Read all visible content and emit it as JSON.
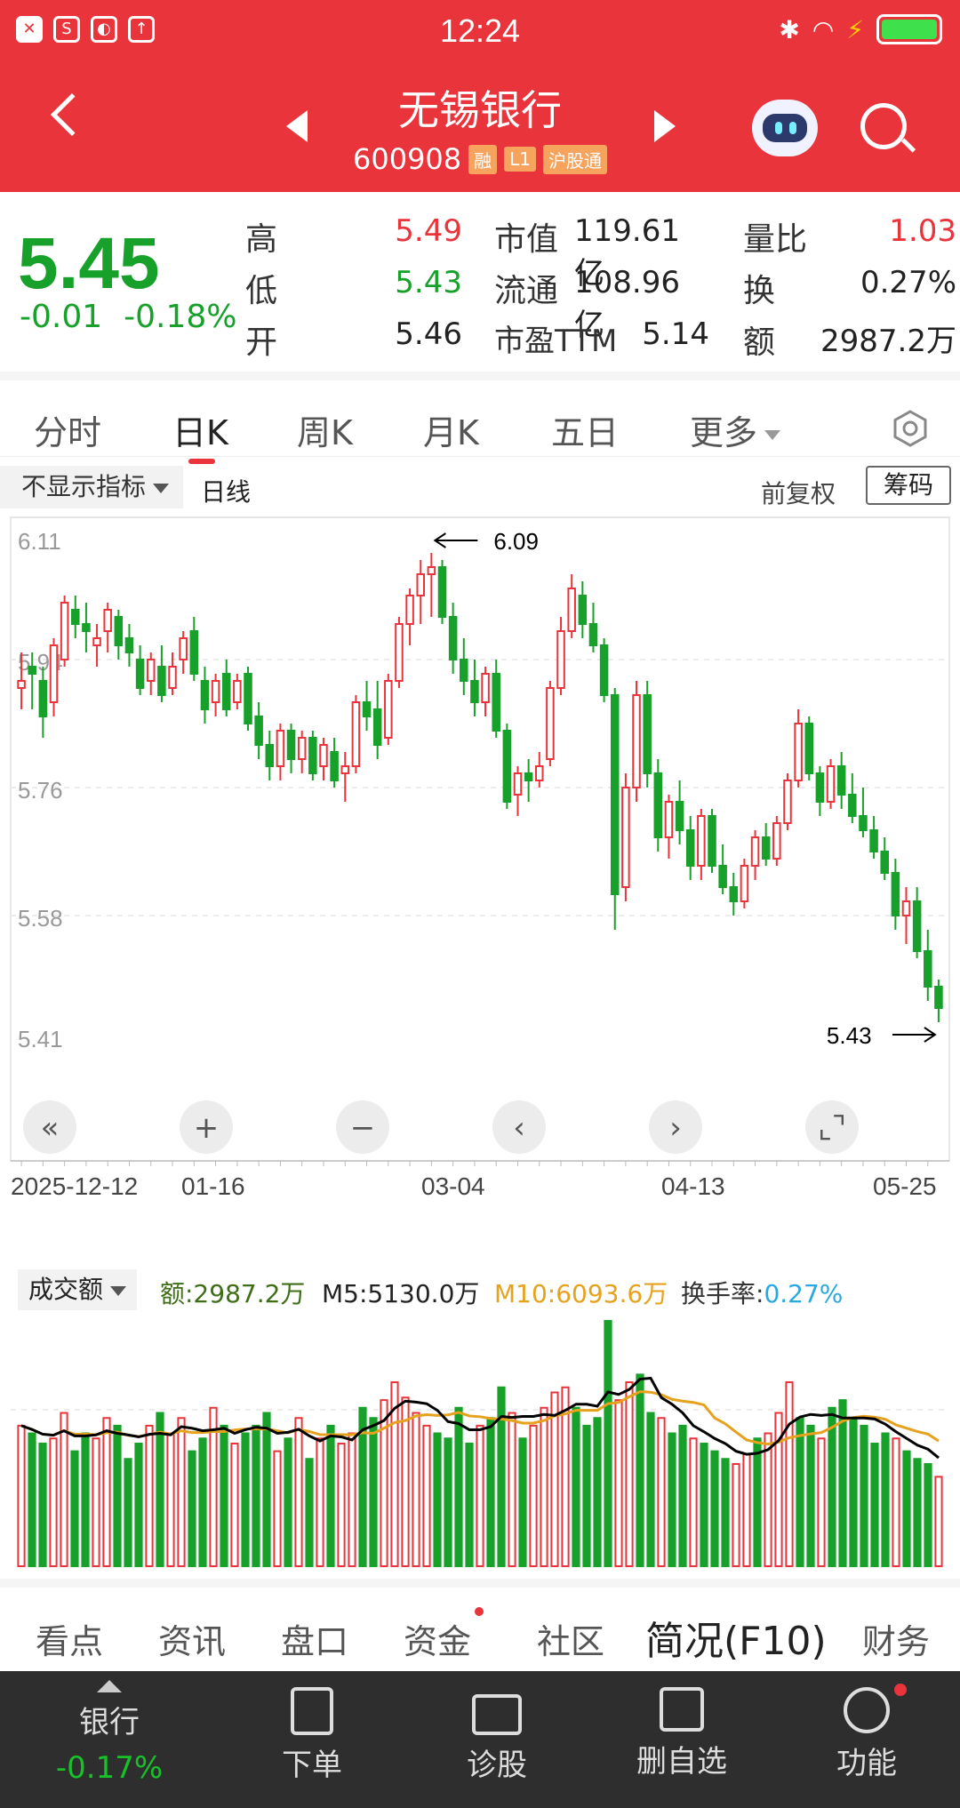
{
  "status_bar": {
    "time": "12:24"
  },
  "header": {
    "stock_name": "无锡银行",
    "stock_code": "600908",
    "tags": [
      "融",
      "L1",
      "沪股通"
    ]
  },
  "quote": {
    "price": "5.45",
    "change": "-0.01",
    "change_pct": "-0.18%",
    "rows": [
      [
        {
          "label": "高",
          "value": "5.49"
        },
        {
          "label": "市值",
          "value": "119.61亿"
        },
        {
          "label": "量比",
          "value": "1.03"
        }
      ],
      [
        {
          "label": "低",
          "value": "5.43"
        },
        {
          "label": "流通",
          "value": "108.96亿"
        },
        {
          "label": "换",
          "value": "0.27%"
        }
      ],
      [
        {
          "label": "开",
          "value": "5.46"
        },
        {
          "label": "市盈TTM",
          "value": "5.14"
        },
        {
          "label": "额",
          "value": "2987.2万"
        }
      ]
    ]
  },
  "tabs": [
    "分时",
    "日K",
    "周K",
    "月K",
    "五日",
    "更多"
  ],
  "indicator_bar": {
    "dropdown": "不显示指标",
    "line_type": "日线",
    "adjust": "前复权",
    "chips_button": "筹码"
  },
  "chart_data": [
    {
      "type": "candlestick",
      "title": "",
      "ylim": [
        5.41,
        6.11
      ],
      "y_ticks": [
        "6.11",
        "5.94",
        "5.76",
        "5.58",
        "5.41"
      ],
      "x_ticks": [
        "2025-12-12",
        "01-16",
        "03-04",
        "04-13",
        "05-25"
      ],
      "annotations": [
        {
          "label": "6.09",
          "kind": "max"
        },
        {
          "label": "5.43",
          "kind": "min"
        }
      ],
      "candles": [
        [
          5.9,
          5.95,
          5.87,
          5.91
        ],
        [
          5.93,
          5.95,
          5.87,
          5.92
        ],
        [
          5.91,
          5.93,
          5.83,
          5.86
        ],
        [
          5.88,
          5.97,
          5.86,
          5.96
        ],
        [
          5.94,
          6.03,
          5.93,
          6.02
        ],
        [
          6.01,
          6.03,
          5.97,
          5.99
        ],
        [
          5.99,
          6.02,
          5.95,
          5.98
        ],
        [
          5.96,
          5.99,
          5.93,
          5.97
        ],
        [
          5.98,
          6.02,
          5.95,
          6.01
        ],
        [
          6.0,
          6.01,
          5.94,
          5.96
        ],
        [
          5.97,
          5.99,
          5.93,
          5.95
        ],
        [
          5.94,
          5.96,
          5.89,
          5.9
        ],
        [
          5.91,
          5.95,
          5.89,
          5.94
        ],
        [
          5.93,
          5.96,
          5.88,
          5.89
        ],
        [
          5.9,
          5.95,
          5.89,
          5.93
        ],
        [
          5.94,
          5.98,
          5.92,
          5.97
        ],
        [
          5.98,
          6.0,
          5.91,
          5.92
        ],
        [
          5.91,
          5.93,
          5.85,
          5.87
        ],
        [
          5.88,
          5.92,
          5.86,
          5.91
        ],
        [
          5.92,
          5.94,
          5.86,
          5.87
        ],
        [
          5.88,
          5.92,
          5.87,
          5.91
        ],
        [
          5.92,
          5.93,
          5.84,
          5.85
        ],
        [
          5.86,
          5.88,
          5.8,
          5.82
        ],
        [
          5.82,
          5.84,
          5.77,
          5.79
        ],
        [
          5.79,
          5.85,
          5.77,
          5.84
        ],
        [
          5.84,
          5.85,
          5.78,
          5.8
        ],
        [
          5.8,
          5.84,
          5.78,
          5.83
        ],
        [
          5.83,
          5.84,
          5.77,
          5.78
        ],
        [
          5.79,
          5.83,
          5.77,
          5.82
        ],
        [
          5.81,
          5.83,
          5.76,
          5.77
        ],
        [
          5.78,
          5.81,
          5.74,
          5.79
        ],
        [
          5.79,
          5.89,
          5.78,
          5.88
        ],
        [
          5.88,
          5.91,
          5.84,
          5.86
        ],
        [
          5.87,
          5.91,
          5.8,
          5.82
        ],
        [
          5.83,
          5.92,
          5.82,
          5.91
        ],
        [
          5.91,
          6.0,
          5.9,
          5.99
        ],
        [
          5.99,
          6.04,
          5.96,
          6.03
        ],
        [
          6.03,
          6.08,
          5.99,
          6.06
        ],
        [
          6.06,
          6.09,
          6.0,
          6.07
        ],
        [
          6.07,
          6.08,
          5.99,
          6.0
        ],
        [
          6.0,
          6.02,
          5.92,
          5.94
        ],
        [
          5.94,
          5.97,
          5.89,
          5.91
        ],
        [
          5.91,
          5.94,
          5.86,
          5.88
        ],
        [
          5.88,
          5.93,
          5.86,
          5.92
        ],
        [
          5.92,
          5.94,
          5.83,
          5.84
        ],
        [
          5.84,
          5.85,
          5.73,
          5.74
        ],
        [
          5.75,
          5.79,
          5.72,
          5.78
        ],
        [
          5.78,
          5.8,
          5.74,
          5.77
        ],
        [
          5.77,
          5.81,
          5.76,
          5.79
        ],
        [
          5.8,
          5.91,
          5.79,
          5.9
        ],
        [
          5.9,
          6.0,
          5.89,
          5.98
        ],
        [
          5.98,
          6.06,
          5.97,
          6.04
        ],
        [
          6.03,
          6.05,
          5.97,
          5.99
        ],
        [
          5.99,
          6.02,
          5.95,
          5.96
        ],
        [
          5.96,
          5.97,
          5.88,
          5.89
        ],
        [
          5.89,
          5.9,
          5.56,
          5.61
        ],
        [
          5.62,
          5.78,
          5.6,
          5.76
        ],
        [
          5.76,
          5.91,
          5.74,
          5.89
        ],
        [
          5.89,
          5.91,
          5.76,
          5.78
        ],
        [
          5.78,
          5.8,
          5.67,
          5.69
        ],
        [
          5.69,
          5.75,
          5.66,
          5.74
        ],
        [
          5.74,
          5.77,
          5.68,
          5.7
        ],
        [
          5.7,
          5.72,
          5.63,
          5.65
        ],
        [
          5.65,
          5.73,
          5.63,
          5.72
        ],
        [
          5.72,
          5.73,
          5.64,
          5.65
        ],
        [
          5.65,
          5.68,
          5.61,
          5.62
        ],
        [
          5.62,
          5.64,
          5.58,
          5.6
        ],
        [
          5.6,
          5.66,
          5.59,
          5.65
        ],
        [
          5.65,
          5.7,
          5.63,
          5.69
        ],
        [
          5.69,
          5.71,
          5.65,
          5.66
        ],
        [
          5.66,
          5.72,
          5.65,
          5.71
        ],
        [
          5.71,
          5.78,
          5.7,
          5.77
        ],
        [
          5.77,
          5.87,
          5.76,
          5.85
        ],
        [
          5.85,
          5.86,
          5.77,
          5.78
        ],
        [
          5.78,
          5.79,
          5.72,
          5.74
        ],
        [
          5.74,
          5.8,
          5.73,
          5.79
        ],
        [
          5.79,
          5.81,
          5.73,
          5.75
        ],
        [
          5.75,
          5.78,
          5.71,
          5.72
        ],
        [
          5.72,
          5.76,
          5.69,
          5.7
        ],
        [
          5.7,
          5.72,
          5.66,
          5.67
        ],
        [
          5.67,
          5.69,
          5.63,
          5.64
        ],
        [
          5.64,
          5.66,
          5.56,
          5.58
        ],
        [
          5.58,
          5.62,
          5.54,
          5.6
        ],
        [
          5.6,
          5.62,
          5.52,
          5.53
        ],
        [
          5.53,
          5.56,
          5.46,
          5.48
        ],
        [
          5.48,
          5.49,
          5.43,
          5.45
        ]
      ]
    },
    {
      "type": "bar",
      "title": "成交额",
      "series_labels": {
        "amount": "额:2987.2万",
        "m5": "M5:5130.0万",
        "m10": "M10:6093.6万",
        "turnover_label": "换手率:",
        "turnover": "0.27%"
      },
      "values": [
        55,
        52,
        48,
        50,
        60,
        45,
        52,
        50,
        58,
        55,
        42,
        48,
        55,
        60,
        52,
        58,
        45,
        50,
        62,
        55,
        48,
        52,
        55,
        60,
        45,
        50,
        58,
        42,
        50,
        55,
        48,
        52,
        62,
        58,
        65,
        72,
        66,
        60,
        55,
        52,
        50,
        62,
        48,
        55,
        58,
        70,
        60,
        50,
        55,
        62,
        68,
        70,
        62,
        55,
        58,
        96,
        65,
        72,
        75,
        60,
        58,
        52,
        55,
        50,
        48,
        45,
        42,
        40,
        44,
        50,
        52,
        60,
        72,
        58,
        55,
        50,
        62,
        65,
        58,
        55,
        48,
        52,
        50,
        45,
        42,
        40,
        35
      ],
      "colors": "red-up-green-down"
    }
  ],
  "chart_controls": [
    "«",
    "+",
    "−",
    "‹",
    "›",
    "⌞⌝"
  ],
  "bottom_tabs": [
    "看点",
    "资讯",
    "盘口",
    "资金",
    "社区",
    "简况(F10)",
    "财务"
  ],
  "dock": {
    "sector_name": "银行",
    "sector_change": "-0.17%",
    "items": [
      "下单",
      "诊股",
      "删自选",
      "功能"
    ]
  },
  "colors": {
    "brand": "#e8343a",
    "up": "#e8343a",
    "down": "#17a12a",
    "ma5": "#000000",
    "ma10": "#e6a11d",
    "turnover": "#2ba7e0"
  }
}
